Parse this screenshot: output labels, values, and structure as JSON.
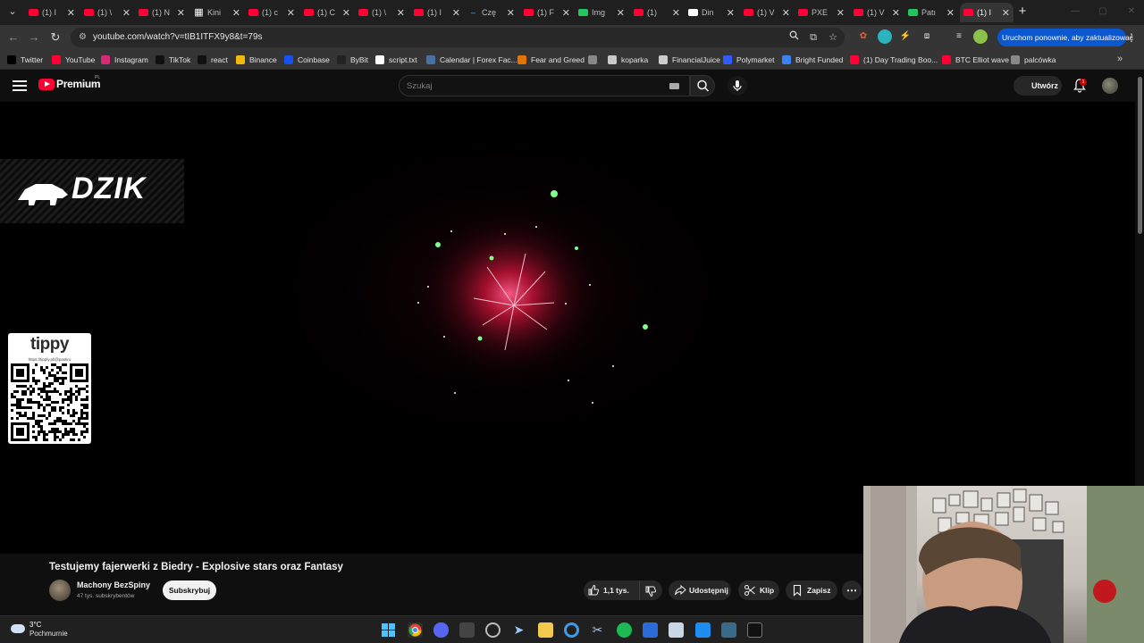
{
  "browser": {
    "tabs": [
      {
        "label": "(1) I",
        "kind": "yt"
      },
      {
        "label": "(1) \\",
        "kind": "yt"
      },
      {
        "label": "(1) N",
        "kind": "yt"
      },
      {
        "label": "Kini",
        "kind": "grid"
      },
      {
        "label": "(1) c",
        "kind": "yt"
      },
      {
        "label": "(1) C",
        "kind": "yt"
      },
      {
        "label": "(1) \\",
        "kind": "yt"
      },
      {
        "label": "(1) I",
        "kind": "yt"
      },
      {
        "label": "Czę",
        "kind": "dash"
      },
      {
        "label": "(1) F",
        "kind": "yt"
      },
      {
        "label": "Img",
        "kind": "img"
      },
      {
        "label": "(1) ",
        "kind": "yt"
      },
      {
        "label": "Din",
        "kind": "doc"
      },
      {
        "label": "(1) V",
        "kind": "yt"
      },
      {
        "label": "PXE",
        "kind": "yt"
      },
      {
        "label": "(1) V",
        "kind": "yt"
      },
      {
        "label": "Patı",
        "kind": "k"
      },
      {
        "label": "(1) I",
        "kind": "yt"
      }
    ],
    "active_tab_index": 17,
    "url": "youtube.com/watch?v=tIB1ITFX9y8&t=79s",
    "update_button": "Uruchom ponownie, aby zaktualizować",
    "bookmarks": [
      {
        "label": "Twitter",
        "icon": "x-icon",
        "color": "#000000"
      },
      {
        "label": "YouTube",
        "icon": "youtube-icon",
        "color": "#ff0033"
      },
      {
        "label": "Instagram",
        "icon": "instagram-icon",
        "color": "#d62976"
      },
      {
        "label": "TikTok",
        "icon": "tiktok-icon",
        "color": "#111111"
      },
      {
        "label": "react",
        "icon": "tiktok-icon",
        "color": "#111111"
      },
      {
        "label": "Binance",
        "icon": "binance-icon",
        "color": "#f0b90b"
      },
      {
        "label": "Coinbase",
        "icon": "coinbase-icon",
        "color": "#1652f0"
      },
      {
        "label": "ByBit",
        "icon": "bybit-icon",
        "color": "#222222"
      },
      {
        "label": "script.txt",
        "icon": "github-icon",
        "color": "#ffffff"
      },
      {
        "label": "Calendar | Forex Fac...",
        "icon": "calendar-icon",
        "color": "#4a6fa5"
      },
      {
        "label": "Fear and Greed",
        "icon": "chrome-icon",
        "color": "#e37400"
      },
      {
        "label": "",
        "icon": "globe-icon",
        "color": "#888888"
      },
      {
        "label": "koparka",
        "icon": "folder-icon",
        "color": "#c9c9c9"
      },
      {
        "label": "FinancialJuice",
        "icon": "fj-icon",
        "color": "#cccccc"
      },
      {
        "label": "Polymarket",
        "icon": "polymarket-icon",
        "color": "#2e5cff"
      },
      {
        "label": "Bright Funded",
        "icon": "bright-icon",
        "color": "#3b82f6"
      },
      {
        "label": "(1) Day Trading Boo...",
        "icon": "youtube-icon",
        "color": "#ff0033"
      },
      {
        "label": "BTC Elliot wave",
        "icon": "youtube-icon",
        "color": "#ff0033"
      },
      {
        "label": "palcówka",
        "icon": "globe-icon",
        "color": "#888888"
      }
    ]
  },
  "youtube": {
    "logo_text": "Premium",
    "country_code": "PL",
    "search_placeholder": "Szukaj",
    "create_label": "Utwórz",
    "notification_count": "1",
    "accent": "#ff0033"
  },
  "player": {
    "dzik_text": "DZIK",
    "tippy_logo": "tippy",
    "tippy_url": "https://tipply.pl/@pastiro"
  },
  "video": {
    "title": "Testujemy fajerwerki z Biedry - Explosive stars oraz Fantasy",
    "channel_name": "Machony BezSpiny",
    "subscribers": "47 tys. subskrybentów",
    "subscribe_label": "Subskrybuj",
    "likes": "1,1 tys.",
    "share_label": "Udostępnij",
    "clip_label": "Klip",
    "save_label": "Zapisz"
  },
  "taskbar": {
    "temperature": "3°C",
    "weather": "Pochmurnie"
  }
}
